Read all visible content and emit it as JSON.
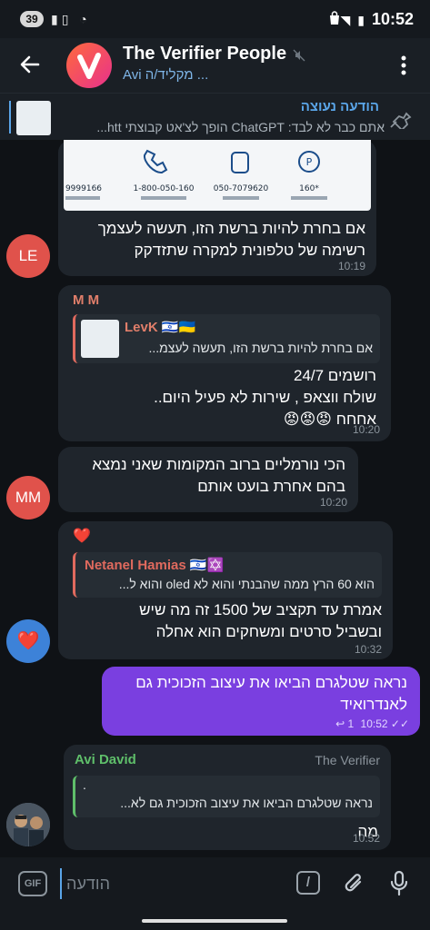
{
  "status_bar": {
    "battery": "39",
    "time": "10:52"
  },
  "header": {
    "title": "The Verifier People",
    "subtitle": "Avi מקליד/ה ..."
  },
  "pinned": {
    "title": "הודעה נעוצה",
    "text": "אתם כבר לא לבד: ChatGPT הופך לצ'אט קבוצתי htt..."
  },
  "messages": [
    {
      "id": "m1",
      "avatar": "LE",
      "avatar_color": "#e0524b",
      "text_line1": "אם בחרת להיות ברשת הזו, תעשה לעצמך",
      "text_line2": "רשימה של טלפונית למקרה שתזדקק",
      "time": "10:19",
      "image_captions": [
        "160*",
        "050-7079620",
        "1-800-050-160",
        "9999166"
      ]
    },
    {
      "id": "m2",
      "sender": "M M",
      "sender_color": "#e07e6a",
      "reply_name": "LevK 🇮🇱🇺🇦",
      "reply_name_color": "#e07e6a",
      "reply_text": "אם בחרת להיות ברשת הזו, תעשה לעצמ...",
      "text_line1": "רושמים 24/7",
      "text_line2": "שולח ווצאפ , שירות לא פעיל היום..",
      "text_line3": "אחחח 😡😡😡",
      "time": "10:20"
    },
    {
      "id": "m3",
      "avatar": "MM",
      "avatar_color": "#e0524b",
      "text_line1": "הכי נורמליים ברוב המקומות שאני נמצא",
      "text_line2": "בהם אחרת בועט אותם",
      "time": "10:20"
    },
    {
      "id": "m4",
      "avatar": "❤️",
      "avatar_color": "#3d82d8",
      "heart": "❤️",
      "reply_name": "Netanel Hamias 🇮🇱✡️",
      "reply_name_color": "#e06a5e",
      "reply_text": "הוא 60 הרץ ממה שהבנתי והוא לא oled והוא ל...",
      "text_line1": "אמרת עד תקציב של 1500 זה מה שיש",
      "text_line2": "ובשביל סרטים ומשחקים הוא אחלה",
      "time": "10:32"
    },
    {
      "id": "m5",
      "outgoing": true,
      "text_line1": "נראה שטלגרם הביאו את עיצוב הזכוכית גם",
      "text_line2": "לאנדרואיד",
      "time": "10:52",
      "replies": "1"
    },
    {
      "id": "m6",
      "avatar_color": "#5a6470",
      "sender": "Avi David",
      "sender_color": "#5fbf6a",
      "badge": "The Verifier",
      "reply_line1": ".",
      "reply_text": "נראה שטלגרם הביאו את עיצוב הזכוכית גם לא...",
      "reply_bar_color": "#5fbf6a",
      "text_line1": "מה",
      "time": "10:52"
    }
  ],
  "input": {
    "placeholder": "הודעה",
    "gif_label": "GIF",
    "command_label": "/"
  },
  "colors": {
    "accent": "#5aa5e8",
    "outgoing_bubble": "#7a3fe0",
    "incoming_bubble": "#1f252c"
  }
}
